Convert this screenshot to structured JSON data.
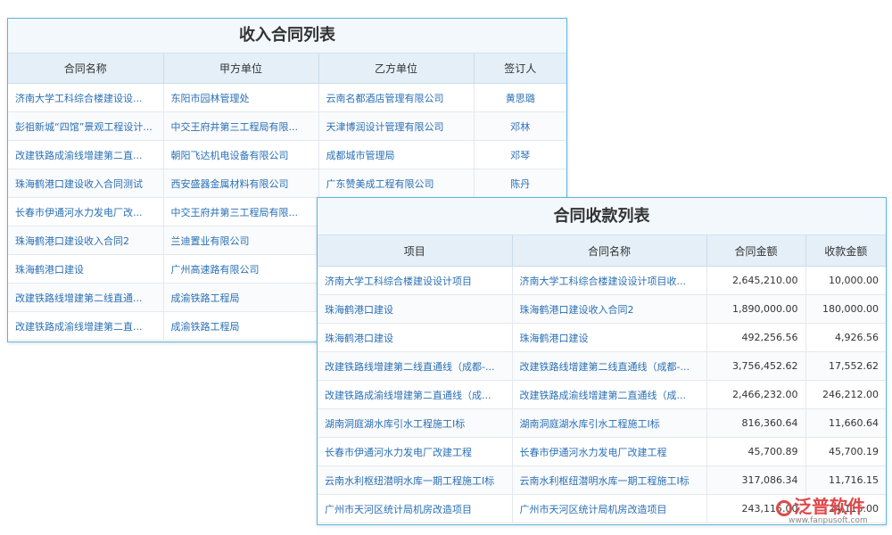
{
  "income_panel": {
    "title": "收入合同列表",
    "headers": [
      "合同名称",
      "甲方单位",
      "乙方单位",
      "签订人"
    ],
    "rows": [
      [
        "济南大学工科综合楼建设设...",
        "东阳市园林管理处",
        "云南名都酒店管理有限公司",
        "黄思璐"
      ],
      [
        "彭祖新城“四馆”景观工程设计...",
        "中交王府井第三工程局有限...",
        "天津博润设计管理有限公司",
        "邓林"
      ],
      [
        "改建铁路成渝线增建第二直...",
        "朝阳飞达机电设备有限公司",
        "成都城市管理局",
        "邓琴"
      ],
      [
        "珠海鹤港口建设收入合同测试",
        "西安盛器金属材料有限公司",
        "广东赞美成工程有限公司",
        "陈丹"
      ],
      [
        "长春市伊通河水力发电厂改...",
        "中交王府井第三工程局有限...",
        "",
        ""
      ],
      [
        "珠海鹤港口建设收入合同2",
        "兰迪置业有限公司",
        "",
        ""
      ],
      [
        "珠海鹤港口建设",
        "广州高速路有限公司",
        "",
        ""
      ],
      [
        "改建铁路线增建第二线直通...",
        "成渝铁路工程局",
        "",
        ""
      ],
      [
        "改建铁路成渝线增建第二直...",
        "成渝铁路工程局",
        "",
        ""
      ]
    ]
  },
  "collection_panel": {
    "title": "合同收款列表",
    "headers": [
      "项目",
      "合同名称",
      "合同金额",
      "收款金额"
    ],
    "rows": [
      [
        "济南大学工科综合楼建设设计项目",
        "济南大学工科综合楼建设设计项目收...",
        "2,645,210.00",
        "10,000.00"
      ],
      [
        "珠海鹤港口建设",
        "珠海鹤港口建设收入合同2",
        "1,890,000.00",
        "180,000.00"
      ],
      [
        "珠海鹤港口建设",
        "珠海鹤港口建设",
        "492,256.56",
        "4,926.56"
      ],
      [
        "改建铁路线增建第二线直通线（成都-...",
        "改建铁路线增建第二线直通线（成都-...",
        "3,756,452.62",
        "17,552.62"
      ],
      [
        "改建铁路成渝线增建第二直通线（成...",
        "改建铁路成渝线增建第二直通线（成...",
        "2,466,232.00",
        "246,212.00"
      ],
      [
        "湖南洞庭湖水库引水工程施工I标",
        "湖南洞庭湖水库引水工程施工I标",
        "816,360.64",
        "11,660.64"
      ],
      [
        "长春市伊通河水力发电厂改建工程",
        "长春市伊通河水力发电厂改建工程",
        "45,700.89",
        "45,700.19"
      ],
      [
        "云南水利枢纽潜明水库一期工程施工I标",
        "云南水利枢纽潜明水库一期工程施工I标",
        "317,086.34",
        "11,716.15"
      ],
      [
        "广州市天河区统计局机房改造项目",
        "广州市天河区统计局机房改造项目",
        "243,115.00",
        "24,115.00"
      ]
    ]
  },
  "watermark": {
    "brand": "泛普软件",
    "url": "www.fanpusoft.com"
  }
}
